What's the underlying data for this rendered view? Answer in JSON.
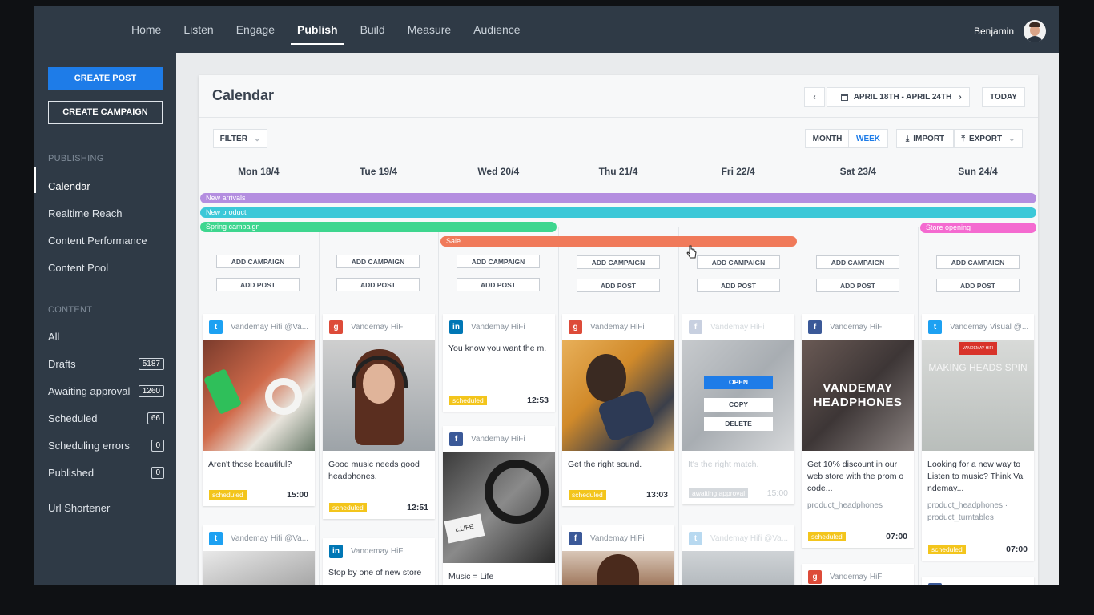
{
  "nav": {
    "items": [
      "Home",
      "Listen",
      "Engage",
      "Publish",
      "Build",
      "Measure",
      "Audience"
    ],
    "active": "Publish",
    "user_name": "Benjamin"
  },
  "sidebar": {
    "create_post": "CREATE POST",
    "create_campaign": "CREATE CAMPAIGN",
    "publishing_heading": "PUBLISHING",
    "publishing_items": [
      "Calendar",
      "Realtime Reach",
      "Content Performance",
      "Content Pool"
    ],
    "content_heading": "CONTENT",
    "content_items": [
      {
        "label": "All",
        "count": ""
      },
      {
        "label": "Drafts",
        "count": "5187"
      },
      {
        "label": "Awaiting approval",
        "count": "1260"
      },
      {
        "label": "Scheduled",
        "count": "66"
      },
      {
        "label": "Scheduling errors",
        "count": "0"
      },
      {
        "label": "Published",
        "count": "0"
      }
    ],
    "url_shortener": "Url Shortener"
  },
  "calendar": {
    "title": "Calendar",
    "date_range": "APRIL 18TH - APRIL 24TH",
    "today": "TODAY",
    "filter": "FILTER",
    "month": "MONTH",
    "week": "WEEK",
    "import": "IMPORT",
    "export": "EXPORT",
    "days": [
      "Mon 18/4",
      "Tue 19/4",
      "Wed 20/4",
      "Thu 21/4",
      "Fri 22/4",
      "Sat 23/4",
      "Sun 24/4"
    ],
    "add_campaign": "ADD CAMPAIGN",
    "add_post": "ADD POST",
    "campaigns": [
      {
        "name": "New arrivals",
        "color": "#b48ee0"
      },
      {
        "name": "New product",
        "color": "#3cc8d8"
      },
      {
        "name": "Spring campaign",
        "color": "#3ed68f"
      },
      {
        "name": "Sale",
        "color": "#f07a5a"
      },
      {
        "name": "Store opening",
        "color": "#f46ad0"
      }
    ]
  },
  "posts": {
    "mon1": {
      "account": "Vandemay Hifi @Va...",
      "text": "Aren't those beautiful?",
      "status": "scheduled",
      "time": "15:00",
      "network": "twitter-icon"
    },
    "mon2": {
      "account": "Vandemay Hifi @Va...",
      "network": "twitter-icon"
    },
    "tue1": {
      "account": "Vandemay HiFi",
      "text": "Good music needs good headphones.",
      "status": "scheduled",
      "time": "12:51",
      "network": "google-plus-icon"
    },
    "tue2": {
      "account": "Vandemay HiFi",
      "text": "Stop by one of new store",
      "network": "linkedin-icon"
    },
    "wed1": {
      "account": "Vandemay HiFi",
      "text": "You know you want the m.",
      "status": "scheduled",
      "time": "12:53",
      "network": "linkedin-icon"
    },
    "wed2": {
      "account": "Vandemay HiFi",
      "text": "Music = Life",
      "img_label": "c.LIFE",
      "network": "facebook-icon"
    },
    "thu1": {
      "account": "Vandemay HiFi",
      "text": "Get the right sound.",
      "status": "scheduled",
      "time": "13:03",
      "network": "google-plus-icon"
    },
    "thu2": {
      "account": "Vandemay HiFi",
      "network": "facebook-icon"
    },
    "fri1": {
      "account": "Vandemay HiFi",
      "text": "It's the right match.",
      "status": "awaiting approval",
      "time": "15:00",
      "open": "OPEN",
      "copy": "COPY",
      "delete": "DELETE",
      "network": "facebook-icon"
    },
    "fri2": {
      "account": "Vandemay Hifi @Va...",
      "network": "twitter-icon"
    },
    "sat1": {
      "account": "Vandemay HiFi",
      "text": "Get 10% discount in our web store with the prom o code...",
      "tags": "product_headphones",
      "status": "scheduled",
      "time": "07:00",
      "img_title": "VANDEMAY HEADPHONES",
      "network": "facebook-icon"
    },
    "sat2": {
      "account": "Vandemay HiFi",
      "network": "google-plus-icon"
    },
    "sun1": {
      "account": "Vandemay Visual @...",
      "text": "Looking for a new way to Listen to music? Think Va ndemay...",
      "tags": "product_headphones · product_turntables",
      "status": "scheduled",
      "time": "07:00",
      "img_badge": "VANDEMAY HIFI",
      "img_title": "MAKING HEADS SPIN",
      "network": "twitter-icon"
    },
    "sun2": {
      "account": "",
      "network": "facebook-icon"
    }
  }
}
